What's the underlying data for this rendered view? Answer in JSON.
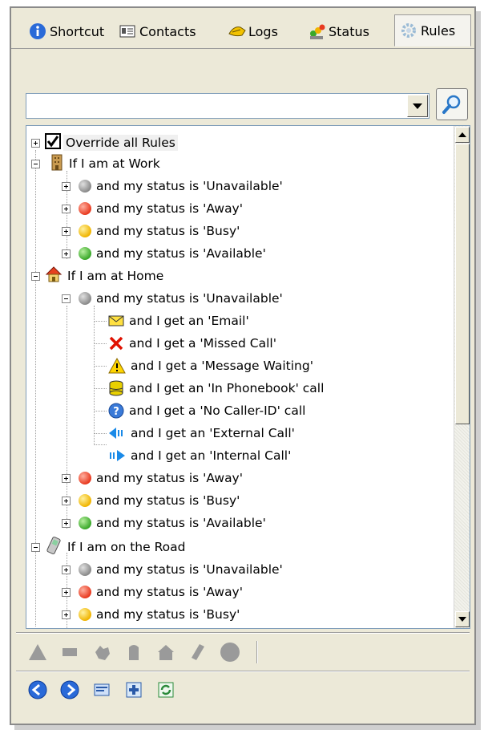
{
  "tabs": [
    {
      "label": "Shortcut",
      "icon": "info-globe-icon"
    },
    {
      "label": "Contacts",
      "icon": "address-card-icon"
    },
    {
      "label": "Logs",
      "icon": "phone-log-icon"
    },
    {
      "label": "Status",
      "icon": "users-status-icon"
    },
    {
      "label": "Rules",
      "icon": "gear-icon",
      "active": true
    }
  ],
  "search": {
    "value": "",
    "placeholder": ""
  },
  "tree": {
    "override": {
      "label": "Override all Rules",
      "checked": true
    },
    "work": {
      "label": "If I am at Work",
      "children": [
        "and my status is 'Unavailable'",
        "and my status is 'Away'",
        "and my status is 'Busy'",
        "and my status is 'Available'"
      ]
    },
    "home": {
      "label": "If I am at Home",
      "unavailable": "and my status is 'Unavailable'",
      "events": [
        "and I get an 'Email'",
        "and I get a 'Missed Call'",
        "and I get a 'Message Waiting'",
        "and I get an 'In Phonebook' call",
        "and I get a 'No Caller-ID' call",
        "and I get an 'External Call'",
        "and I get an 'Internal Call'"
      ],
      "others": [
        "and my status is 'Away'",
        "and my status is 'Busy'",
        "and my status is 'Available'"
      ]
    },
    "road": {
      "label": "If I am on the Road",
      "children": [
        "and my status is 'Unavailable'",
        "and my status is 'Away'",
        "and my status is 'Busy'"
      ]
    }
  },
  "toolbar_top": [
    "triangle-icon",
    "rectangle-icon",
    "pointer-hand-icon",
    "office-building-icon",
    "house-icon",
    "mobile-phone-icon",
    "circle-icon"
  ],
  "toolbar_bottom": [
    "back-arrow-icon",
    "forward-arrow-icon",
    "card-icon",
    "add-item-icon",
    "refresh-icon"
  ],
  "colors": {
    "status_grey": "#8a8a8a",
    "status_red": "#e83a20",
    "status_yellow": "#f0b400",
    "status_green": "#3aa82a",
    "accent_blue": "#2a6ad8"
  }
}
